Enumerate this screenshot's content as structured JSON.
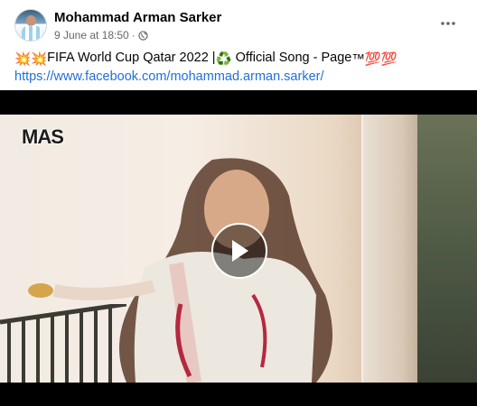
{
  "post": {
    "author": "Mohammad Arman Sarker",
    "timestamp": "9 June at 18:50",
    "separator": "·",
    "privacy_icon": "globe-icon",
    "more_icon": "more-horizontal-icon",
    "caption_prefix_emoji": "💥💥",
    "caption_text": "FIFA World Cup Qatar 2022 |",
    "caption_recycle_emoji": "♻️",
    "caption_text_2": " Official Song - Page",
    "caption_suffix_emoji": "™💯💯",
    "link": "https://www.facebook.com/mohammad.arman.sarker/"
  },
  "video": {
    "watermark": "MAS",
    "play_icon": "play-icon"
  },
  "colors": {
    "link": "#216fdb",
    "meta": "#65676b",
    "text": "#050505"
  }
}
